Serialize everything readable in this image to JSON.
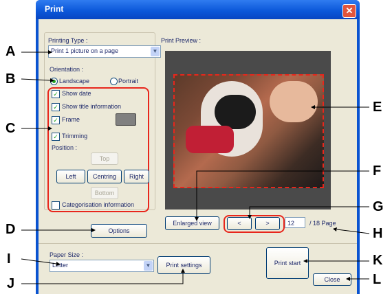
{
  "dialog": {
    "title": "Print",
    "close_glyph": "✕"
  },
  "printing_type": {
    "label": "Printing Type :",
    "value": "Print 1 picture on a page"
  },
  "orientation": {
    "label": "Orientation :",
    "landscape": "Landscape",
    "portrait": "Portrait",
    "selected": "Landscape"
  },
  "options": {
    "show_date": "Show date",
    "show_title": "Show title information",
    "frame": "Frame",
    "trimming": "Trimming",
    "position_label": "Position :",
    "top": "Top",
    "left": "Left",
    "centring": "Centring",
    "right": "Right",
    "bottom": "Bottom",
    "categorisation": "Categorisation information",
    "options_button": "Options"
  },
  "preview": {
    "label": "Print Preview :",
    "enlarged": "Enlarged view",
    "prev": "<",
    "next": ">",
    "page": "12",
    "total": "/ 18 Page"
  },
  "paper": {
    "label": "Paper Size :",
    "value": "Letter",
    "settings": "Print settings"
  },
  "actions": {
    "start": "Print start",
    "close": "Close"
  },
  "callouts": [
    "A",
    "B",
    "C",
    "D",
    "E",
    "F",
    "G",
    "H",
    "I",
    "J",
    "K",
    "L"
  ],
  "colors": {
    "accent_red": "#e8261c",
    "title_blue": "#0A53D0",
    "dialog_bg": "#ECE9D8"
  }
}
